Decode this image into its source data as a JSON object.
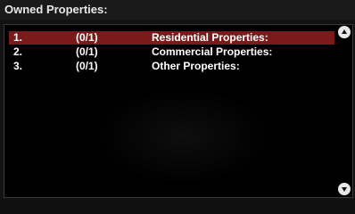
{
  "window": {
    "title": "Owned Properties:"
  },
  "list": {
    "selected_color": "#7a1a1a",
    "rows": [
      {
        "number": "1.",
        "count": "(0/1)",
        "label": "Residential Properties:",
        "selected": true
      },
      {
        "number": "2.",
        "count": "(0/1)",
        "label": "Commercial Properties:",
        "selected": false
      },
      {
        "number": "3.",
        "count": "(0/1)",
        "label": "Other Properties:",
        "selected": false
      }
    ]
  },
  "scrollbar": {
    "up_icon": "arrow-up-icon",
    "down_icon": "arrow-down-icon"
  }
}
